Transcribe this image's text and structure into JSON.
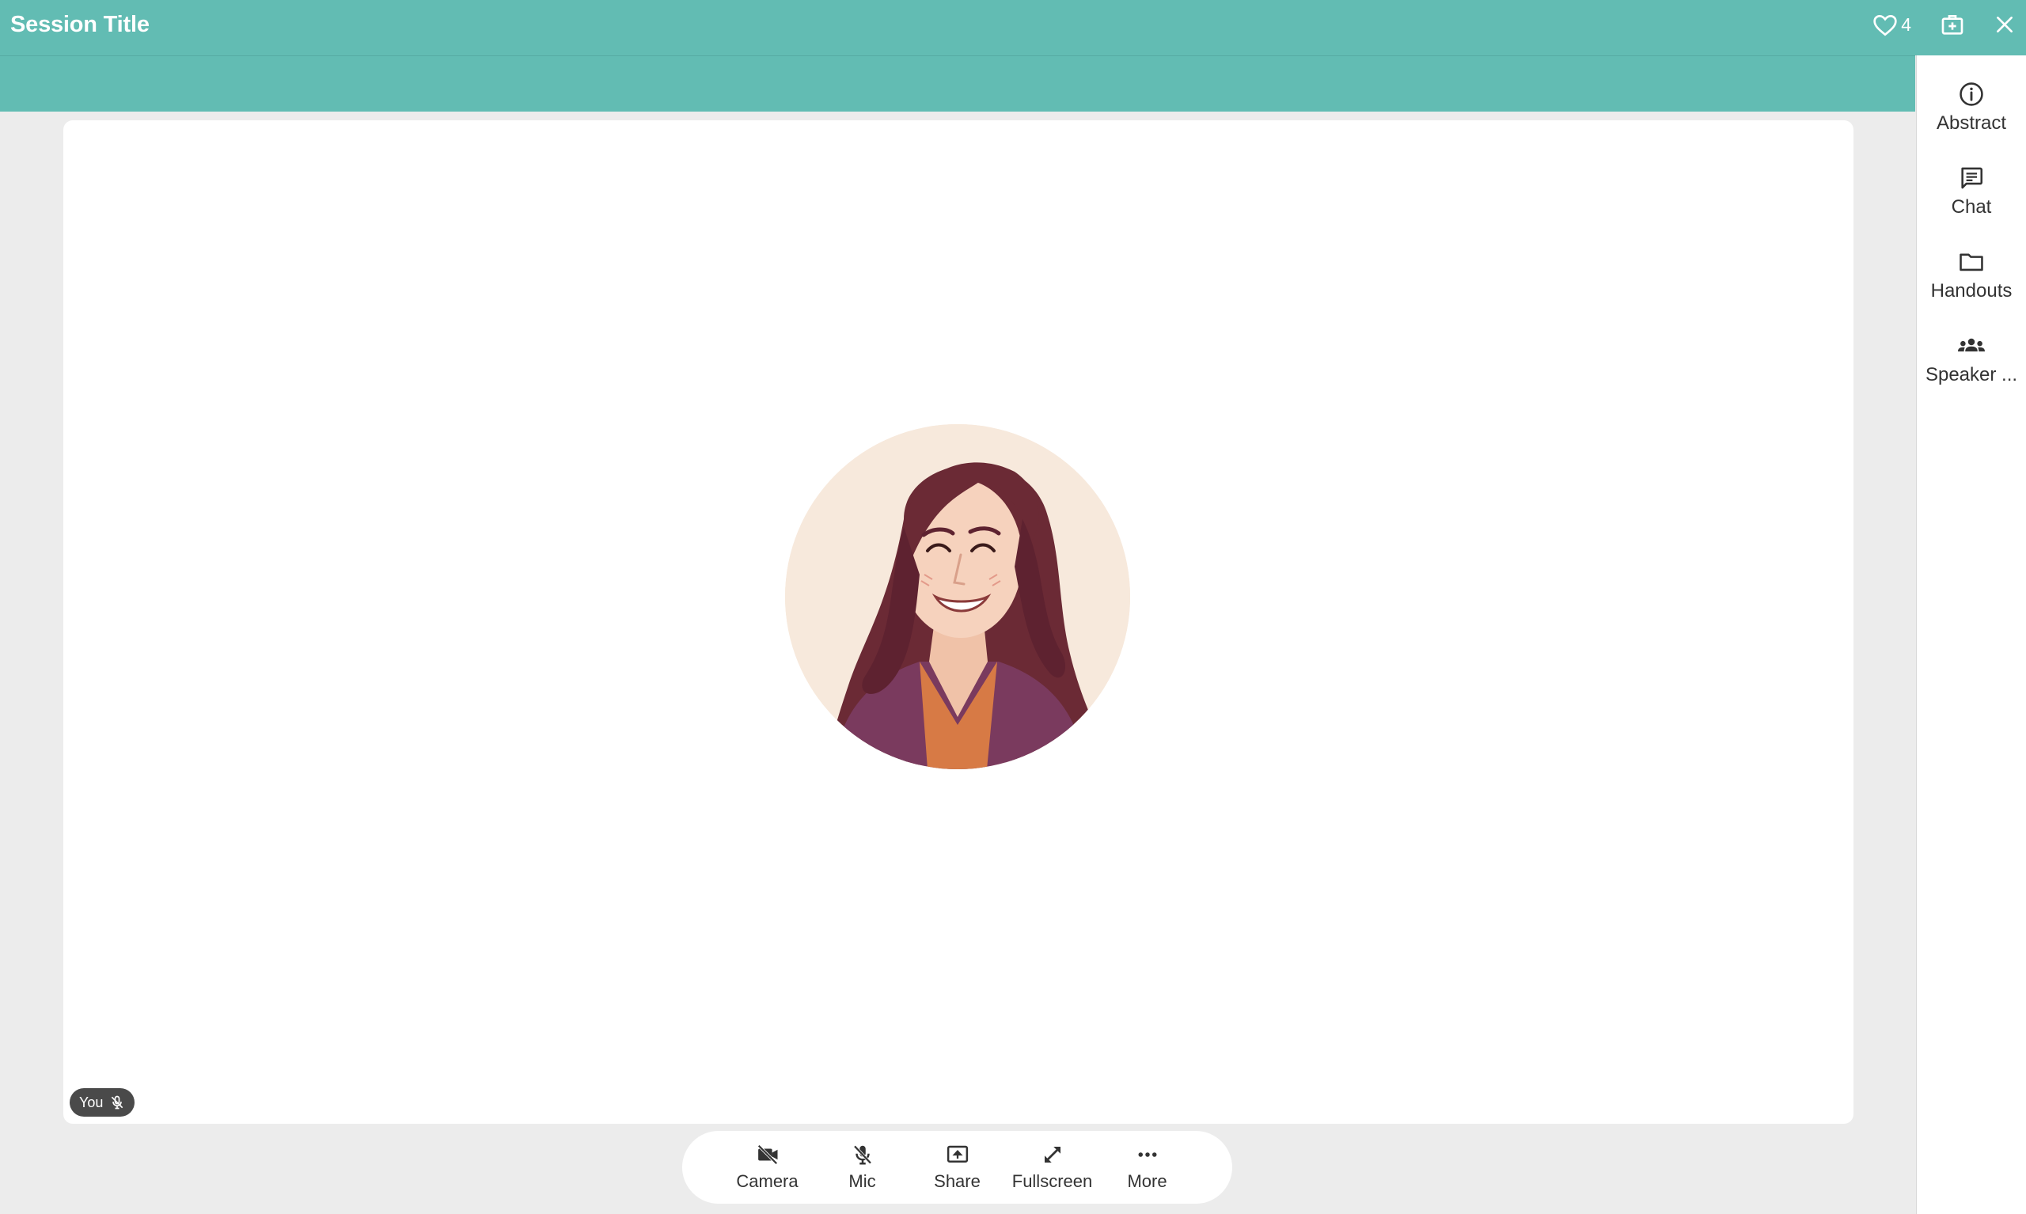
{
  "window": {
    "title": "Session Title",
    "favorite_count": "4",
    "accent_color": "#62bcb3"
  },
  "titlebar_icons": {
    "favorite": "heart-outline-icon",
    "add": "briefcase-plus-icon",
    "close": "close-icon"
  },
  "sidebar": {
    "items": [
      {
        "label": "Abstract",
        "icon": "info-circle-icon"
      },
      {
        "label": "Chat",
        "icon": "chat-bubble-icon"
      },
      {
        "label": "Handouts",
        "icon": "folder-icon"
      },
      {
        "label": "Speaker ...",
        "icon": "people-group-icon"
      }
    ]
  },
  "stage": {
    "participant_label": "You",
    "participant_mic_icon": "mic-off-icon",
    "avatar": "illustrated-woman-avatar"
  },
  "controls": {
    "items": [
      {
        "label": "Camera",
        "icon": "camera-off-icon"
      },
      {
        "label": "Mic",
        "icon": "mic-off-icon"
      },
      {
        "label": "Share",
        "icon": "screen-share-icon"
      },
      {
        "label": "Fullscreen",
        "icon": "expand-arrows-icon"
      },
      {
        "label": "More",
        "icon": "more-dots-icon"
      }
    ]
  }
}
